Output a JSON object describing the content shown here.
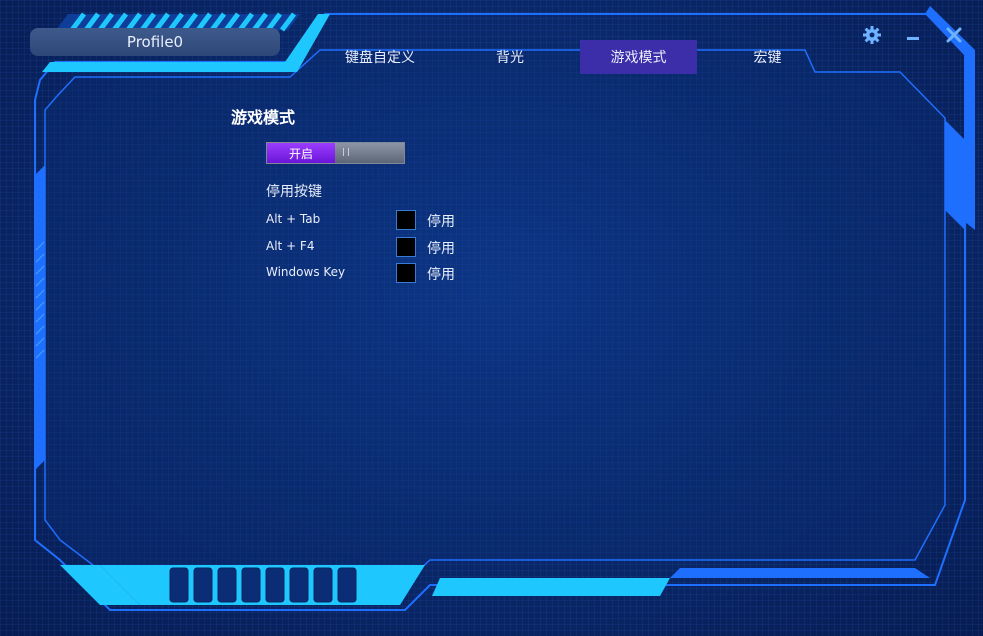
{
  "profile": {
    "name": "Profile0"
  },
  "tabs": [
    {
      "label": "键盘自定义",
      "active": false
    },
    {
      "label": "背光",
      "active": false
    },
    {
      "label": "游戏模式",
      "active": true
    },
    {
      "label": "宏键",
      "active": false
    }
  ],
  "window_controls": {
    "settings_icon": "gear-icon",
    "minimize_icon": "minimize-icon",
    "close_icon": "close-icon"
  },
  "game_mode": {
    "title": "游戏模式",
    "toggle": {
      "on_label": "开启",
      "state": "on"
    },
    "disable_keys_title": "停用按键",
    "keys": [
      {
        "label": "Alt + Tab",
        "checkbox_label": "停用",
        "checked": false
      },
      {
        "label": "Alt + F4",
        "checkbox_label": "停用",
        "checked": false
      },
      {
        "label": "Windows Key",
        "checkbox_label": "停用",
        "checked": false
      }
    ]
  },
  "colors": {
    "accent_cyan": "#1ec8ff",
    "accent_blue": "#1f6fff",
    "active_tab": "#3b2ea8",
    "toggle_on": "#8a2be2",
    "background": "#0a2a6e"
  }
}
